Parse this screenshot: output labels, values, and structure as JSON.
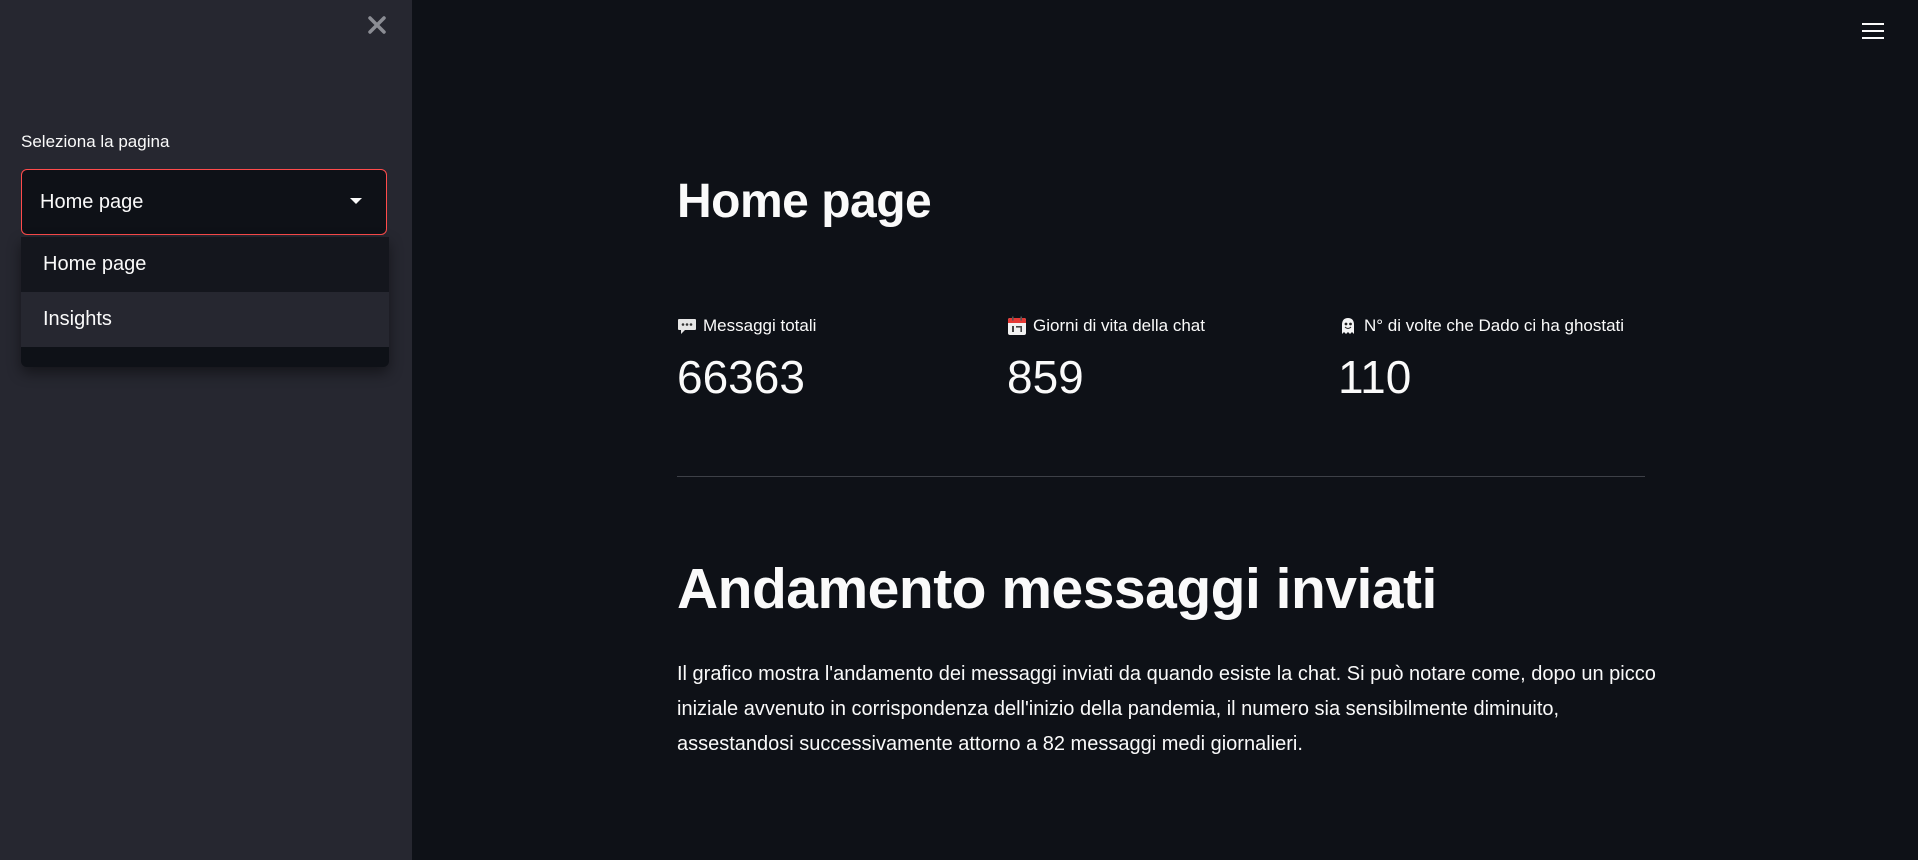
{
  "sidebar": {
    "select_label": "Seleziona la pagina",
    "selected_value": "Home page",
    "options": [
      "Home page",
      "Insights"
    ]
  },
  "main": {
    "title": "Home page",
    "metrics": [
      {
        "icon": "speech-bubble-icon",
        "label": "Messaggi totali",
        "value": "66363"
      },
      {
        "icon": "calendar-icon",
        "label": "Giorni di vita della chat",
        "value": "859"
      },
      {
        "icon": "ghost-icon",
        "label": "N° di volte che Dado ci ha ghostati",
        "value": "110"
      }
    ],
    "section_title": "Andamento messaggi inviati",
    "section_text": "Il grafico mostra l'andamento dei messaggi inviati da quando esiste la chat. Si può notare come, dopo un picco iniziale avvenuto in corrispondenza dell'inizio della pandemia, il numero sia sensibilmente diminuito, assestandosi successivamente attorno a 82 messaggi medi giornalieri."
  },
  "colors": {
    "background": "#0e1117",
    "sidebar": "#262730",
    "accent": "#ff4b4b",
    "text": "#fafafa"
  }
}
